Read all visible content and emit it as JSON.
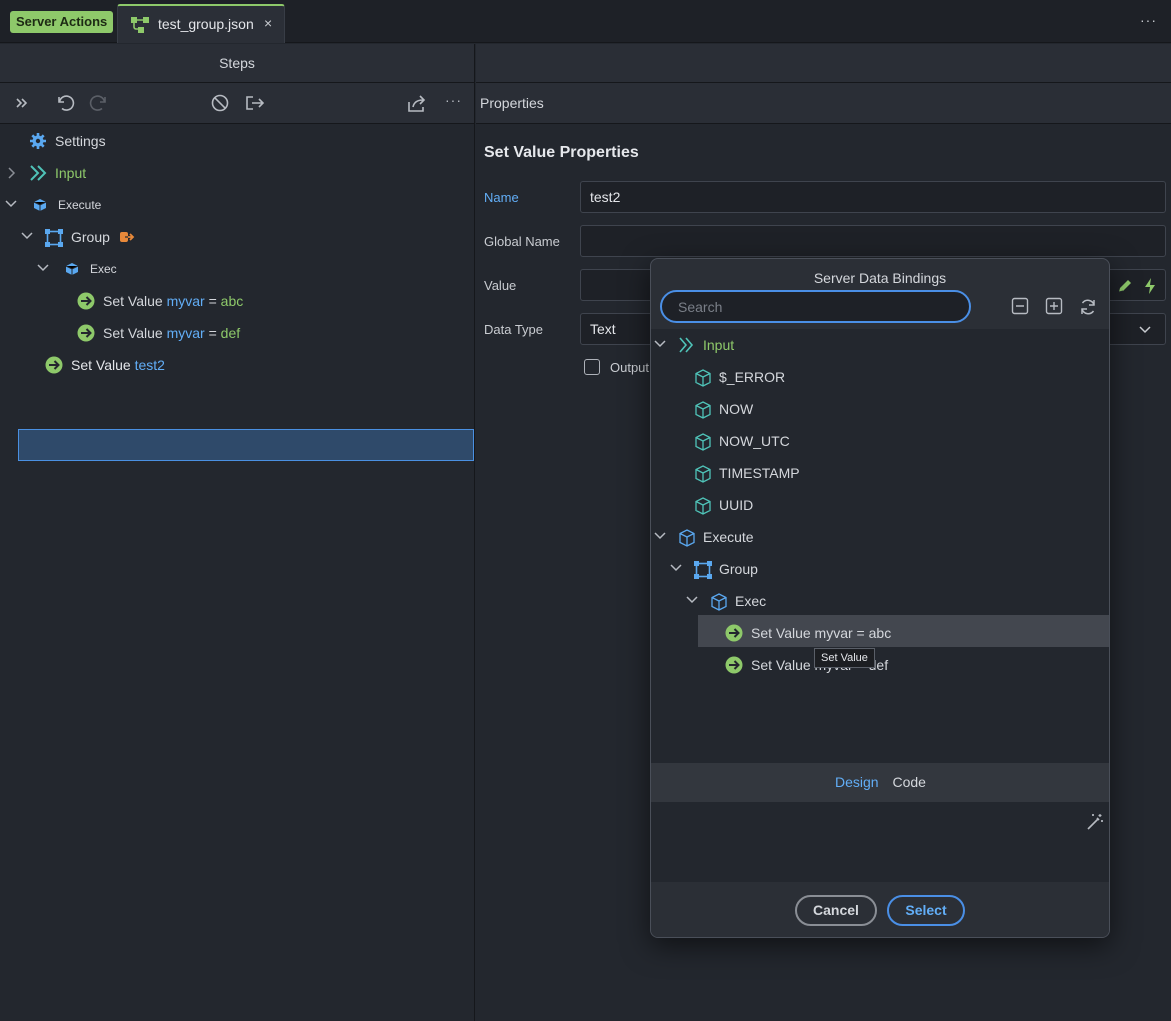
{
  "tabbar": {
    "badge": "Server Actions",
    "file_tab": "test_group.json",
    "close_glyph": "×",
    "more_glyph": "···"
  },
  "steps": {
    "header": "Steps",
    "toolbar_more": "···",
    "tree": [
      {
        "label": "Settings",
        "icon": "gear-icon"
      },
      {
        "label": "Input",
        "icon": "input-chevrons-icon"
      },
      {
        "label": "Execute",
        "icon": "cube-icon"
      },
      {
        "label": "Group",
        "icon": "group-icon"
      },
      {
        "label": "Exec",
        "icon": "cube-icon"
      },
      {
        "label": "Set Value",
        "var": "myvar",
        "eq": "=",
        "val": "abc",
        "icon": "set-value-icon"
      },
      {
        "label": "Set Value",
        "var": "myvar",
        "eq": "=",
        "val": "def",
        "icon": "set-value-icon"
      },
      {
        "label": "Set Value",
        "var": "test2",
        "icon": "set-value-icon",
        "selected": true
      }
    ]
  },
  "properties": {
    "header": "Properties",
    "title": "Set Value Properties",
    "name_label": "Name",
    "name_value": "test2",
    "global_name_label": "Global Name",
    "global_name_value": "",
    "value_label": "Value",
    "data_type_label": "Data Type",
    "data_type_value": "Text",
    "output_label": "Output"
  },
  "dialog": {
    "title": "Server Data Bindings",
    "search_placeholder": "Search",
    "tree": [
      {
        "label": "Input"
      },
      {
        "label": "$_ERROR"
      },
      {
        "label": "NOW"
      },
      {
        "label": "NOW_UTC"
      },
      {
        "label": "TIMESTAMP"
      },
      {
        "label": "UUID"
      },
      {
        "label": "Execute"
      },
      {
        "label": "Group"
      },
      {
        "label": "Exec"
      },
      {
        "label": "Set Value myvar = abc"
      },
      {
        "label": "Set Value myvar = def"
      }
    ],
    "tooltip": "Set Value",
    "tab_design": "Design",
    "tab_code": "Code",
    "cancel": "Cancel",
    "select": "Select"
  },
  "colors": {
    "accent_green": "#8ec96a",
    "accent_blue": "#62aef7",
    "background": "#23272e"
  }
}
